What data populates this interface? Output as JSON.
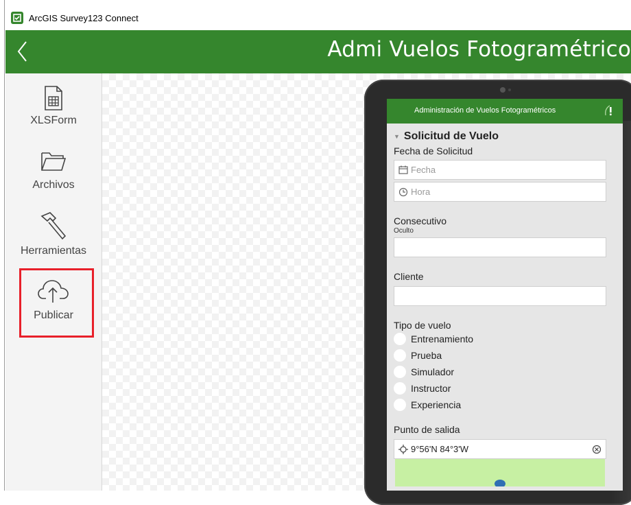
{
  "window": {
    "title": "ArcGIS Survey123 Connect"
  },
  "header": {
    "title": "Admi Vuelos Fotogramétrico"
  },
  "sidebar": {
    "items": [
      {
        "label": "XLSForm",
        "icon": "spreadsheet-file-icon"
      },
      {
        "label": "Archivos",
        "icon": "folder-icon"
      },
      {
        "label": "Herramientas",
        "icon": "hammer-icon"
      },
      {
        "label": "Publicar",
        "icon": "cloud-upload-icon"
      }
    ]
  },
  "preview": {
    "app_title": "Administración de Vuelos Fotogramétricos",
    "group_title": "Solicitud de Vuelo",
    "fecha_solicitud_label": "Fecha de Solicitud",
    "fecha_placeholder": "Fecha",
    "hora_placeholder": "Hora",
    "consecutivo_label": "Consecutivo",
    "consecutivo_hint": "Oculto",
    "cliente_label": "Cliente",
    "tipo_vuelo_label": "Tipo de vuelo",
    "tipo_vuelo_options": [
      "Entrenamiento",
      "Prueba",
      "Simulador",
      "Instructor",
      "Experiencia"
    ],
    "punto_salida_label": "Punto de salida",
    "punto_salida_value": "9°56'N 84°3'W"
  },
  "colors": {
    "brand_green": "#35862d",
    "highlight_red": "#e8202a",
    "map_green": "#c7f0a3"
  }
}
